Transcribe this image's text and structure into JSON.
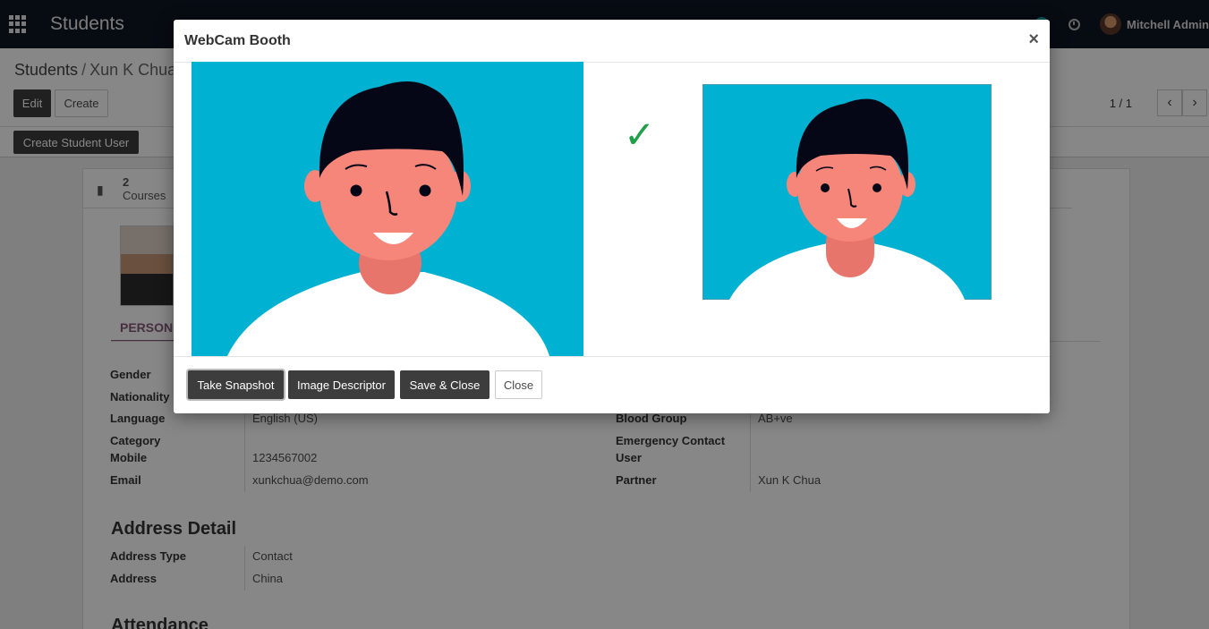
{
  "app": {
    "title": "Students",
    "user_name": "Mitchell Admin"
  },
  "breadcrumb": {
    "parent": "Students",
    "separator": "/",
    "current": "Xun K Chua"
  },
  "toolbar": {
    "edit_label": "Edit",
    "create_label": "Create",
    "pager": "1 / 1",
    "create_student_user_label": "Create Student User"
  },
  "smart_button": {
    "count": "2",
    "label": "Courses"
  },
  "form": {
    "tab_label": "PERSON",
    "left_fields": [
      {
        "label": "Gender",
        "value": ""
      },
      {
        "label": "Nationality",
        "value": ""
      },
      {
        "label": "Language",
        "value": "English (US)"
      },
      {
        "label": "Category",
        "value": ""
      },
      {
        "label": "Mobile",
        "value": "1234567002"
      },
      {
        "label": "Email",
        "value": "xunkchua@demo.com"
      }
    ],
    "right_fields": [
      {
        "label": "Blood Group",
        "value": "AB+ve"
      },
      {
        "label": "Emergency Contact",
        "value": ""
      },
      {
        "label": "User",
        "value": ""
      },
      {
        "label": "Partner",
        "value": "Xun K Chua"
      }
    ],
    "address_section_title": "Address Detail",
    "address_fields": [
      {
        "label": "Address Type",
        "value": "Contact"
      },
      {
        "label": "Address",
        "value": "China"
      }
    ],
    "attendance_section_title": "Attendance"
  },
  "modal": {
    "title": "WebCam Booth",
    "close_symbol": "×",
    "checkmark": "✓",
    "buttons": {
      "take_snapshot": "Take Snapshot",
      "image_descriptor": "Image Descriptor",
      "save_close": "Save & Close",
      "close": "Close"
    }
  },
  "colors": {
    "topbar": "#0f1522",
    "webcam_bg": "#00b1d2",
    "skin": "#f7867a",
    "hair": "#050716",
    "shirt": "#ffffff",
    "checkmark": "#21a04a",
    "primary_button": "#3d3d3d"
  }
}
